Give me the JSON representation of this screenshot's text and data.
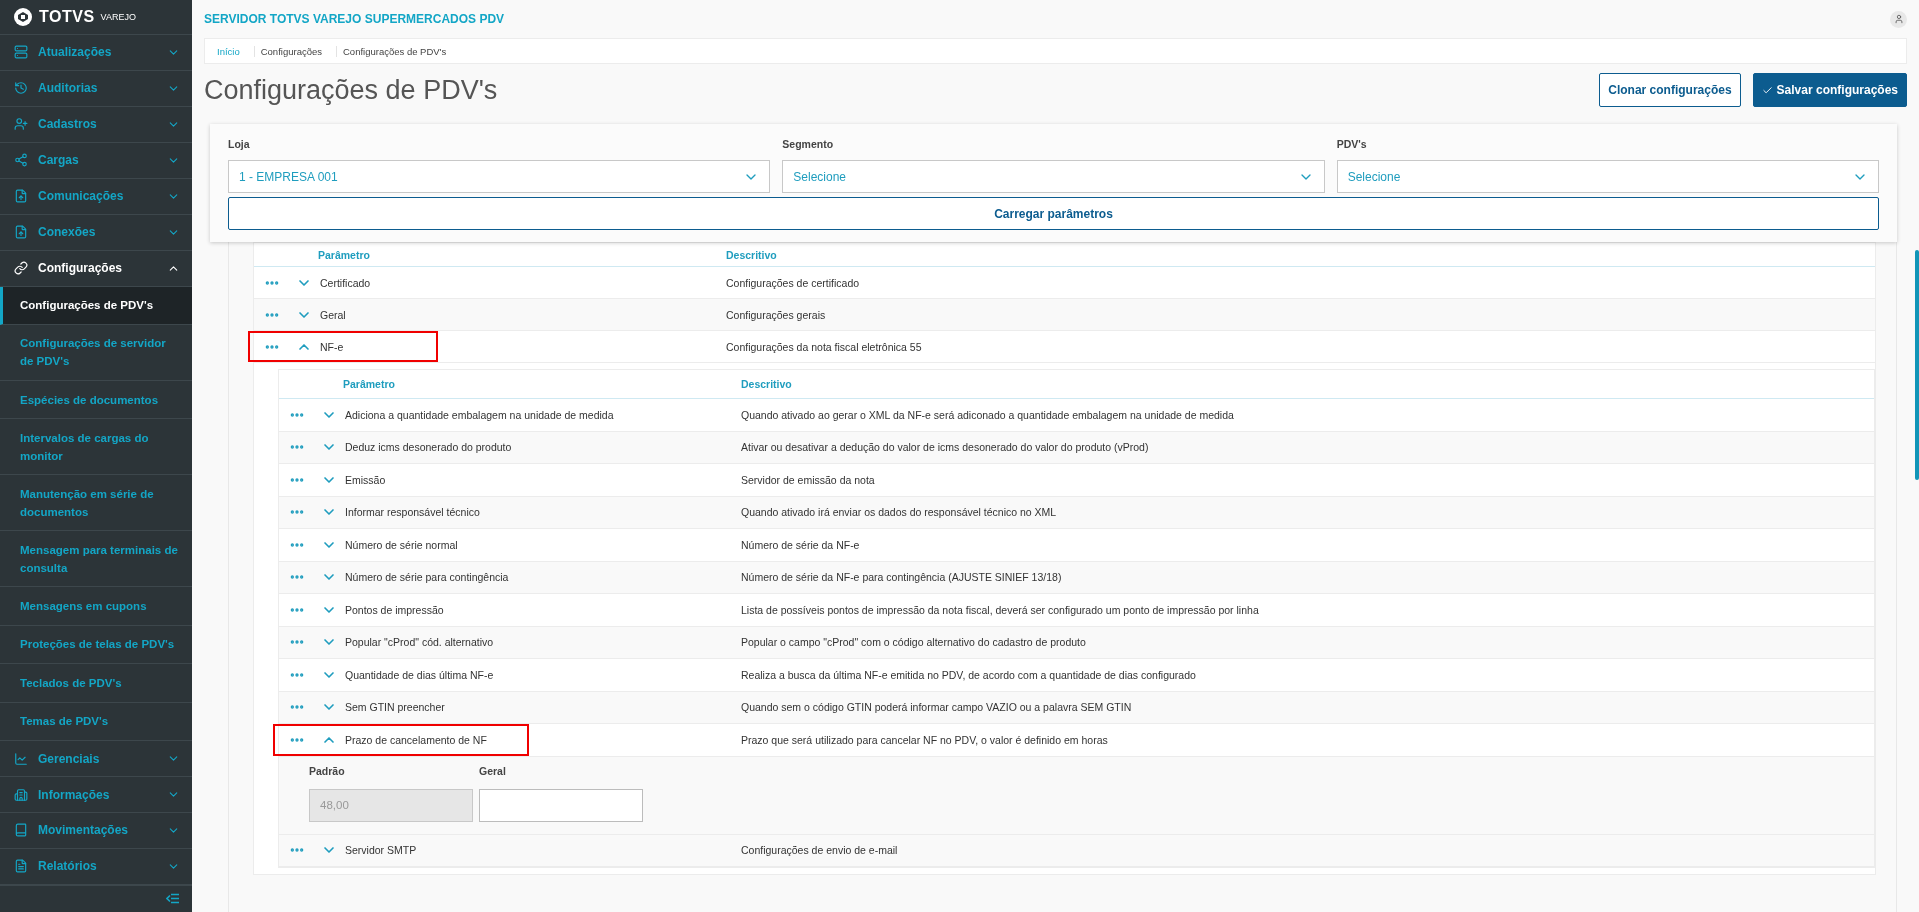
{
  "sidebar": {
    "brand": "TOTVS",
    "brand_sub": "VAREJO",
    "items": [
      {
        "label": "Atualizações",
        "expanded": false
      },
      {
        "label": "Auditorias",
        "expanded": false
      },
      {
        "label": "Cadastros",
        "expanded": false
      },
      {
        "label": "Cargas",
        "expanded": false
      },
      {
        "label": "Comunicações",
        "expanded": false
      },
      {
        "label": "Conexões",
        "expanded": false
      },
      {
        "label": "Configurações",
        "expanded": true,
        "children": [
          {
            "label": "Configurações de PDV's",
            "selected": true
          },
          {
            "label": "Configurações de servidor de PDV's",
            "selected": false
          },
          {
            "label": "Espécies de documentos",
            "selected": false
          },
          {
            "label": "Intervalos de cargas do monitor",
            "selected": false
          },
          {
            "label": "Manutenção em série de documentos",
            "selected": false
          },
          {
            "label": "Mensagem para terminais de consulta",
            "selected": false
          },
          {
            "label": "Mensagens em cupons",
            "selected": false
          },
          {
            "label": "Proteções de telas de PDV's",
            "selected": false
          },
          {
            "label": "Teclados de PDV's",
            "selected": false
          },
          {
            "label": "Temas de PDV's",
            "selected": false
          }
        ]
      },
      {
        "label": "Gerenciais",
        "expanded": false
      },
      {
        "label": "Informações",
        "expanded": false
      },
      {
        "label": "Movimentações",
        "expanded": false
      },
      {
        "label": "Relatórios",
        "expanded": false
      }
    ]
  },
  "header": {
    "title": "SERVIDOR TOTVS VAREJO SUPERMERCADOS PDV"
  },
  "breadcrumb": [
    {
      "label": "Início",
      "link": true
    },
    {
      "label": "Configurações",
      "link": false
    },
    {
      "label": "Configurações de PDV's",
      "link": false
    }
  ],
  "page_title": "Configurações de PDV's",
  "actions": [
    {
      "label": "Clonar configurações",
      "kind": "secondary"
    },
    {
      "label": "Salvar configurações",
      "kind": "primary"
    }
  ],
  "filters": [
    {
      "label": "Loja",
      "value": "1 - EMPRESA 001"
    },
    {
      "label": "Segmento",
      "placeholder": "Selecione"
    },
    {
      "label": "PDV's",
      "placeholder": "Selecione"
    }
  ],
  "load_button": "Carregar parâmetros",
  "table": {
    "columns": [
      "Parâmetro",
      "Descritivo"
    ],
    "rows": [
      {
        "parameter": "Certificado",
        "description": "Configurações de certificado",
        "expanded": false,
        "highlighted": false
      },
      {
        "parameter": "Geral",
        "description": "Configurações gerais",
        "expanded": false,
        "highlighted": false
      },
      {
        "parameter": "NF-e",
        "description": "Configurações da nota fiscal eletrônica 55",
        "expanded": true,
        "highlighted": true,
        "children": {
          "columns": [
            "Parâmetro",
            "Descritivo"
          ],
          "rows": [
            {
              "parameter": "Adiciona a quantidade embalagem na unidade de medida",
              "description": "Quando ativado ao gerar o XML da NF-e será adiconado a quantidade embalagem na unidade de medida",
              "expanded": false,
              "highlighted": false
            },
            {
              "parameter": "Deduz icms desonerado do produto",
              "description": "Ativar ou desativar a dedução do valor de icms desonerado do valor do produto (vProd)",
              "expanded": false,
              "highlighted": false
            },
            {
              "parameter": "Emissão",
              "description": "Servidor de emissão da nota",
              "expanded": false,
              "highlighted": false
            },
            {
              "parameter": "Informar responsável técnico",
              "description": "Quando ativado irá enviar os dados do responsável técnico no XML",
              "expanded": false,
              "highlighted": false
            },
            {
              "parameter": "Número de série normal",
              "description": "Número de série da NF-e",
              "expanded": false,
              "highlighted": false
            },
            {
              "parameter": "Número de série para contingência",
              "description": "Número de série da NF-e para contingência (AJUSTE SINIEF 13/18)",
              "expanded": false,
              "highlighted": false
            },
            {
              "parameter": "Pontos de impressão",
              "description": "Lista de possíveis pontos de impressão da nota fiscal, deverá ser configurado um ponto de impressão por linha",
              "expanded": false,
              "highlighted": false
            },
            {
              "parameter": "Popular \"cProd\" cód. alternativo",
              "description": "Popular o campo \"cProd\" com o código alternativo do cadastro de produto",
              "expanded": false,
              "highlighted": false
            },
            {
              "parameter": "Quantidade de dias última NF-e",
              "description": "Realiza a busca da última NF-e emitida no PDV, de acordo com a quantidade de dias configurado",
              "expanded": false,
              "highlighted": false
            },
            {
              "parameter": "Sem GTIN preencher",
              "description": "Quando sem o código GTIN poderá informar campo VAZIO ou a palavra SEM GTIN",
              "expanded": false,
              "highlighted": false
            },
            {
              "parameter": "Prazo de cancelamento de NF",
              "description": "Prazo que será utilizado para cancelar NF no PDV, o valor é definido em horas",
              "expanded": true,
              "highlighted": true,
              "fields": [
                {
                  "label": "Padrão",
                  "value": "48,00",
                  "disabled": true
                },
                {
                  "label": "Geral",
                  "disabled": false
                }
              ]
            },
            {
              "parameter": "Servidor SMTP",
              "description": "Configurações de envio de e-mail",
              "expanded": false,
              "highlighted": false
            }
          ]
        }
      }
    ]
  }
}
